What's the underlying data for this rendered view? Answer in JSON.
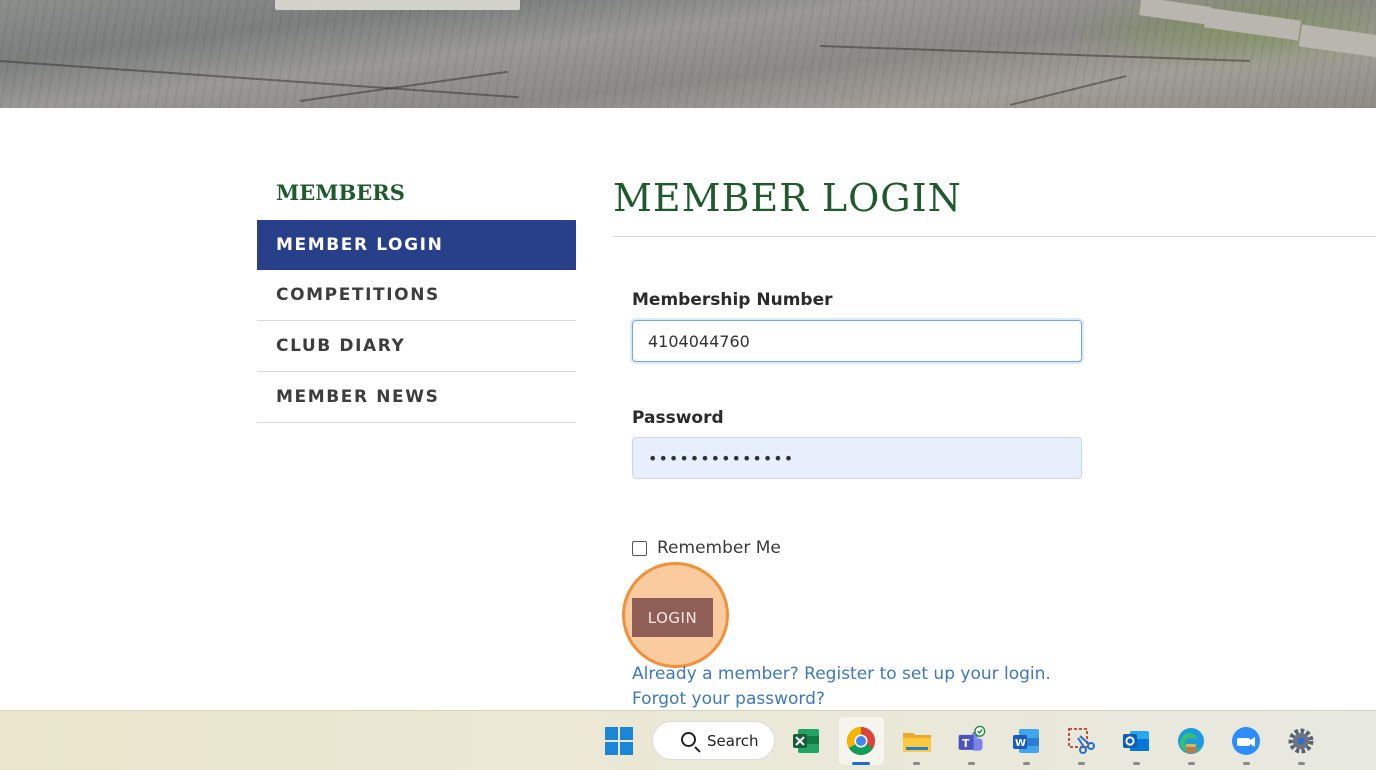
{
  "sidebar": {
    "title": "MEMBERS",
    "items": [
      {
        "label": "MEMBER LOGIN",
        "active": true
      },
      {
        "label": "COMPETITIONS",
        "active": false
      },
      {
        "label": "CLUB DIARY",
        "active": false
      },
      {
        "label": "MEMBER NEWS",
        "active": false
      }
    ]
  },
  "main": {
    "title": "MEMBER LOGIN",
    "membership_label": "Membership Number",
    "membership_value": "4104044760",
    "password_label": "Password",
    "password_value": "••••••••••••••",
    "remember_label": "Remember Me",
    "remember_checked": false,
    "login_button": "LOGIN",
    "register_link": "Already a member? Register to set up your login.",
    "forgot_link": "Forgot your password?"
  },
  "taskbar": {
    "search_label": "Search",
    "apps": [
      "windows-start",
      "search",
      "excel",
      "chrome",
      "file-explorer",
      "teams",
      "word",
      "snipping-tool",
      "outlook",
      "edge",
      "zoom",
      "settings"
    ]
  },
  "colors": {
    "green_heading": "#1e5a2c",
    "nav_active": "#283f8a",
    "login_button": "#8f5e57",
    "link": "#3f78b8",
    "highlight": "#f0913a"
  }
}
